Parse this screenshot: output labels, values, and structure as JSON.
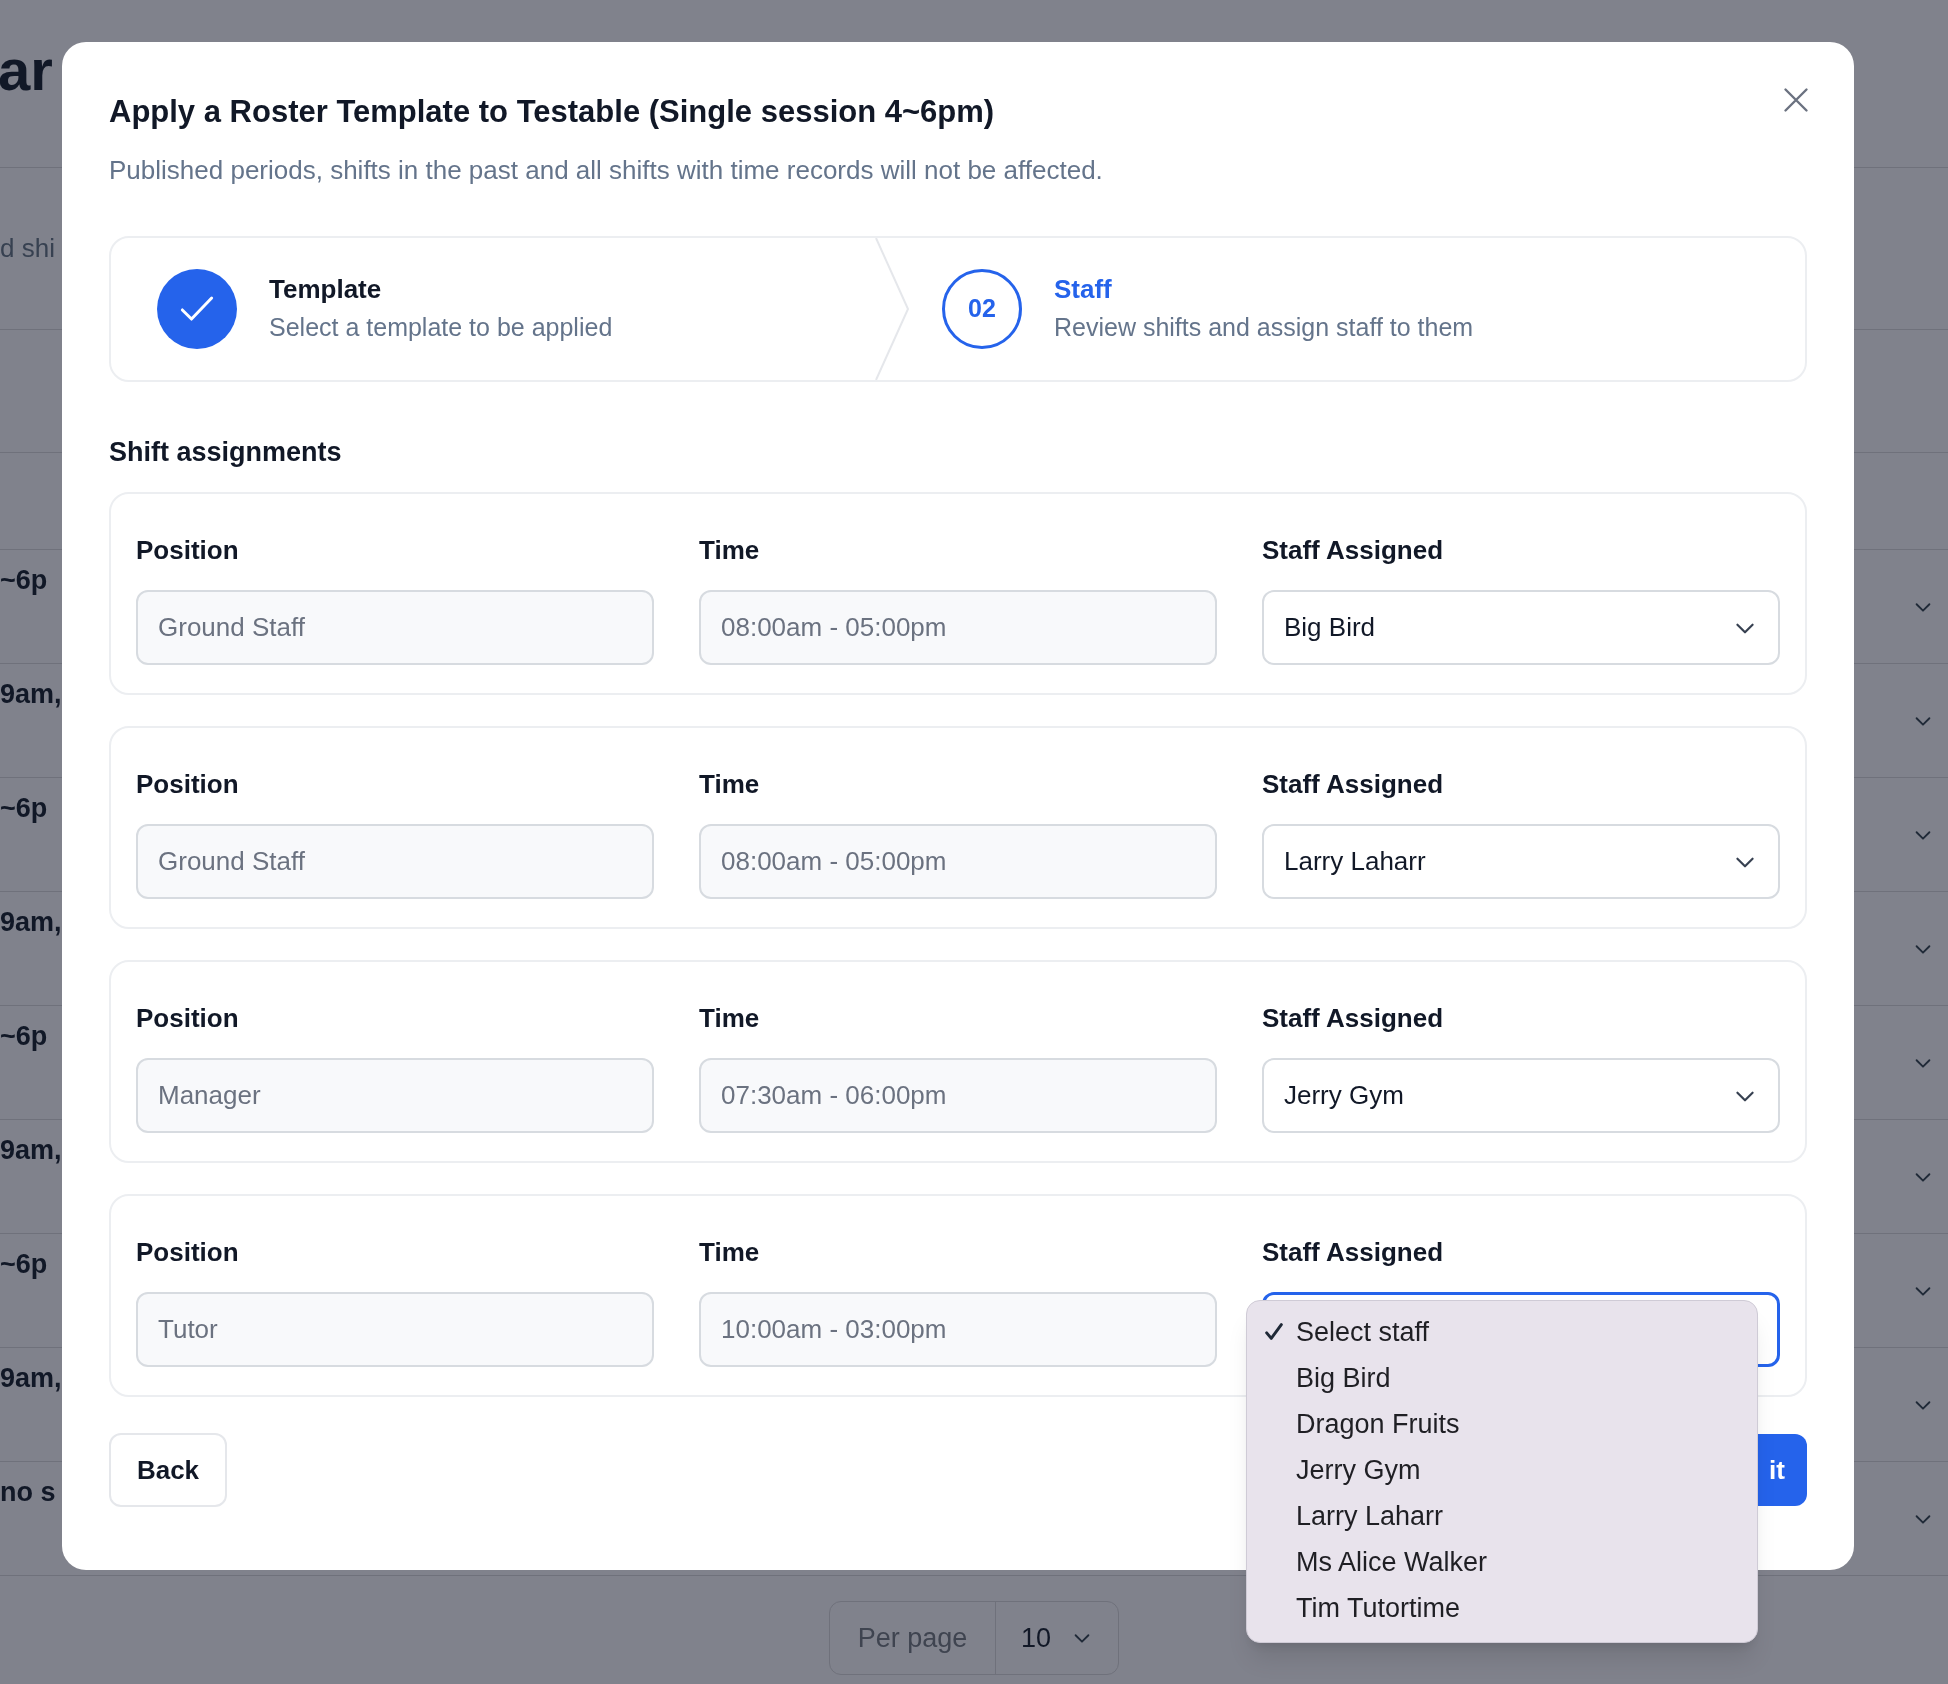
{
  "background": {
    "heading": "ar",
    "subheading": "d shi",
    "rows": [
      {
        "text": "~6p"
      },
      {
        "text": "9am,"
      },
      {
        "text": "~6p"
      },
      {
        "text": "9am,"
      },
      {
        "text": "~6p"
      },
      {
        "text": "9am,"
      },
      {
        "text": "~6p"
      },
      {
        "text": "9am,"
      },
      {
        "text": "no s"
      }
    ]
  },
  "pagination": {
    "label": "Per page",
    "value": "10"
  },
  "dialog": {
    "title": "Apply a Roster Template to Testable (Single session 4~6pm)",
    "subtitle": "Published periods, shifts in the past and all shifts with time records will not be affected.",
    "steps": [
      {
        "title": "Template",
        "description": "Select a template to be applied",
        "completed": true,
        "selected": false
      },
      {
        "number": "02",
        "title": "Staff",
        "description": "Review shifts and assign staff to them",
        "completed": false,
        "selected": true
      }
    ],
    "section_title": "Shift assignments",
    "shifts": [
      {
        "position_label": "Position",
        "position": "Ground Staff",
        "time_label": "Time",
        "time": "08:00am - 05:00pm",
        "staff_label": "Staff Assigned",
        "staff": "Big Bird",
        "focused": false
      },
      {
        "position_label": "Position",
        "position": "Ground Staff",
        "time_label": "Time",
        "time": "08:00am - 05:00pm",
        "staff_label": "Staff Assigned",
        "staff": "Larry Laharr",
        "focused": false
      },
      {
        "position_label": "Position",
        "position": "Manager",
        "time_label": "Time",
        "time": "07:30am - 06:00pm",
        "staff_label": "Staff Assigned",
        "staff": "Jerry Gym",
        "focused": false
      },
      {
        "position_label": "Position",
        "position": "Tutor",
        "time_label": "Time",
        "time": "10:00am - 03:00pm",
        "staff_label": "Staff Assigned",
        "focused": true
      }
    ],
    "back_button": "Back",
    "submit_button": "it"
  },
  "dropdown": {
    "options": [
      {
        "label": "Select staff",
        "selected": true
      },
      {
        "label": "Big Bird",
        "selected": false
      },
      {
        "label": "Dragon Fruits",
        "selected": false
      },
      {
        "label": "Jerry Gym",
        "selected": false
      },
      {
        "label": "Larry Laharr",
        "selected": false
      },
      {
        "label": "Ms Alice Walker",
        "selected": false
      },
      {
        "label": "Tim Tutortime",
        "selected": false
      }
    ]
  }
}
